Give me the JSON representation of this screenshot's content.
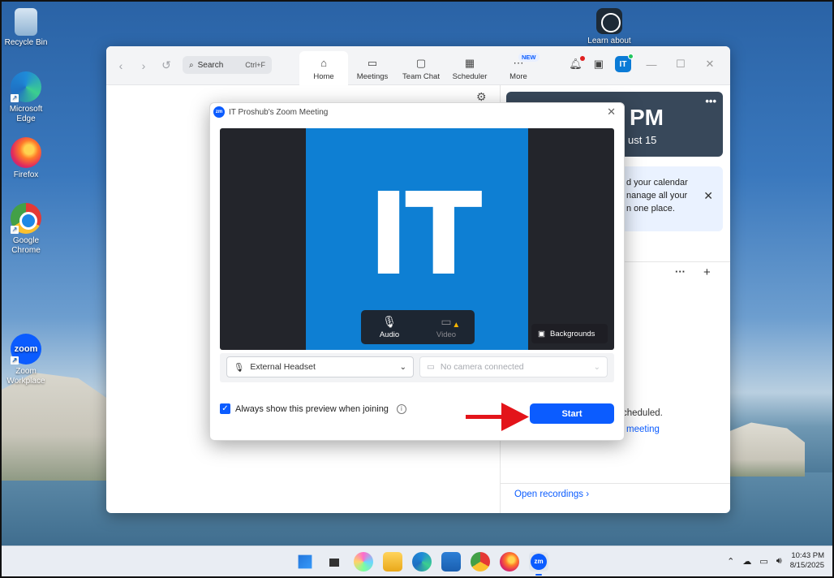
{
  "desktop": {
    "icons": [
      {
        "label": "Recycle Bin",
        "icon": "recycle-bin-icon"
      },
      {
        "label": "Microsoft Edge",
        "icon": "edge-icon"
      },
      {
        "label": "Firefox",
        "icon": "firefox-icon"
      },
      {
        "label": "Google Chrome",
        "icon": "chrome-icon"
      },
      {
        "label": "Zoom Workplace",
        "icon": "zoom-icon"
      },
      {
        "label": "Learn about",
        "icon": "learn-about-icon"
      }
    ]
  },
  "zoom": {
    "search": {
      "label": "Search",
      "shortcut": "Ctrl+F"
    },
    "tabs": [
      {
        "label": "Home",
        "icon": "home-icon"
      },
      {
        "label": "Meetings",
        "icon": "video-icon"
      },
      {
        "label": "Team Chat",
        "icon": "chat-icon"
      },
      {
        "label": "Scheduler",
        "icon": "calendar-icon"
      },
      {
        "label": "More",
        "icon": "more-icon",
        "badge": "NEW"
      }
    ],
    "avatar": "IT",
    "right_panel": {
      "time": "PM",
      "date": "ust 15",
      "calendar_text": [
        "d your calendar",
        "nanage all your",
        "n one place."
      ],
      "scheduled_text": "cheduled.",
      "meeting_link": "meeting",
      "open_recordings": "Open recordings"
    }
  },
  "dialog": {
    "title": "IT Proshub's Zoom Meeting",
    "logo": "zm",
    "video_text": "IT",
    "audio_label": "Audio",
    "video_label": "Video",
    "backgrounds_label": "Backgrounds",
    "mic_device": "External Headset",
    "camera_device": "No camera connected",
    "checkbox_label": "Always show this preview when joining",
    "checkbox_checked": true,
    "start_label": "Start"
  },
  "taskbar": {
    "time": "10:43 PM",
    "date": "8/15/2025",
    "apps": [
      "start-icon",
      "task-view-icon",
      "copilot-icon",
      "file-explorer-icon",
      "edge-icon",
      "store-icon",
      "chrome-icon",
      "firefox-icon",
      "zoom-icon"
    ],
    "zoom_label": "zm"
  },
  "colors": {
    "zoom_blue": "#0b5cff",
    "arrow_red": "#e3141a",
    "it_tile": "#0e7fd3"
  }
}
